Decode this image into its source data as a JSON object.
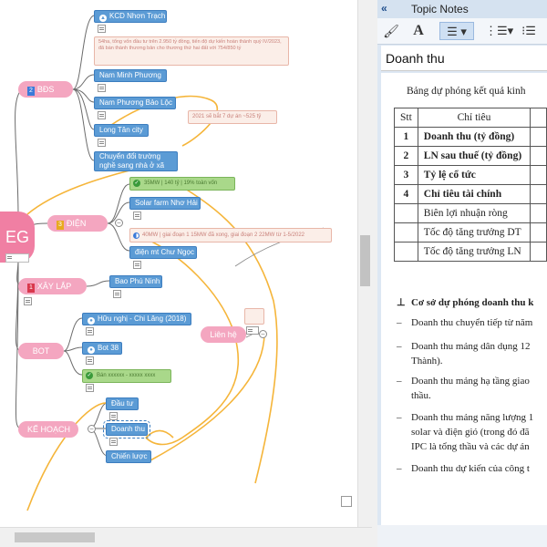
{
  "mindmap": {
    "central_label": "EG",
    "branches": {
      "bds": {
        "num": "2",
        "label": "BĐS"
      },
      "dien": {
        "num": "3",
        "label": "ĐIỆN"
      },
      "xaylap": {
        "num": "1",
        "label": "XÂY LẮP"
      },
      "bot": {
        "label": "BOT"
      },
      "kehoach": {
        "label": "KẾ HOẠCH"
      },
      "lienhe": {
        "label": "Liên hệ"
      }
    },
    "topics": {
      "kcd": "KCD Nhơn Trạch",
      "kcd_note": "54ha, tổng vốn đầu tư trên 2.950 tỷ đồng, tiến độ dự kiến hoàn thành quý IV/2023, đã bàn thành thương bản cho thương thứ hai đất với 754/850 tỷ",
      "nam_minh_phuong": "Nam Minh Phương",
      "nam_phuong_bao_loc": "Nam Phương Bảo Lộc",
      "long_tan_city": "Long Tân city",
      "long_tan_note": "2021 sẽ bắt 7 dự án ~525 tỷ",
      "chuyen_doi": "Chuyển đổi trường nghề sang nhà ở xã hội",
      "solar_green": "35MW | 140 tỷ | 19% toàn vốn",
      "solar_farm": "Solar farm Nhơ Hải",
      "dien_gio_note": "40MW | giai đoạn 1 15MW đã xong, giai đoạn 2 22MW từ 1-5/2022",
      "dien_gio": "điện mt Chư Ngọc",
      "bao_phu_ninh": "Bao Phú Ninh",
      "huu_nghi": "Hữu nghị - Chi Lăng (2018)",
      "bot38": "Bot 38",
      "bot_green": "Bán xxxxxx - xxxxx xxxx",
      "dau_tu": "Đầu tư",
      "doanh_thu": "Doanh thu",
      "chien_luoc": "Chiến lược"
    }
  },
  "panel": {
    "title": "Topic Notes",
    "note_title": "Doanh thu",
    "doc_heading": "Bảng dự phóng kết quả kinh",
    "table_headers": [
      "Stt",
      "Chỉ tiêu"
    ],
    "table_rows": [
      {
        "stt": "1",
        "label": "Doanh thu (tỷ đồng)",
        "bold": true
      },
      {
        "stt": "2",
        "label": "LN sau thuế (tỷ đồng)",
        "bold": true
      },
      {
        "stt": "3",
        "label": "Tỷ lệ cổ tức",
        "bold": true
      },
      {
        "stt": "4",
        "label": "Chỉ tiêu tài chính",
        "bold": true
      },
      {
        "stt": "",
        "label": "Biên lợi nhuận ròng",
        "bold": false
      },
      {
        "stt": "",
        "label": "Tốc độ tăng trưởng DT",
        "bold": false
      },
      {
        "stt": "",
        "label": "Tốc độ tăng trưởng LN",
        "bold": false
      }
    ],
    "bullets": [
      {
        "marker": "⊥",
        "text": "Cơ sở dự phóng doanh thu k",
        "bold": true
      },
      {
        "marker": "–",
        "text": "Doanh thu chuyển tiếp từ năm",
        "bold": false
      },
      {
        "marker": "–",
        "text": "Doanh thu mảng dân dụng 12",
        "bold": false
      },
      {
        "marker": "",
        "text": "Thành).",
        "bold": false
      },
      {
        "marker": "–",
        "text": "Doanh thu mảng hạ tầng giao",
        "bold": false
      },
      {
        "marker": "",
        "text": "thầu.",
        "bold": false
      },
      {
        "marker": "–",
        "text": "Doanh thu mảng năng lượng 1",
        "bold": false
      },
      {
        "marker": "",
        "text": "solar và điện gió (trong đó đã",
        "bold": false
      },
      {
        "marker": "",
        "text": "IPC là tổng thầu và các dự án",
        "bold": false
      },
      {
        "marker": "–",
        "text": "Doanh thu dự kiến của công t",
        "bold": false
      }
    ]
  }
}
